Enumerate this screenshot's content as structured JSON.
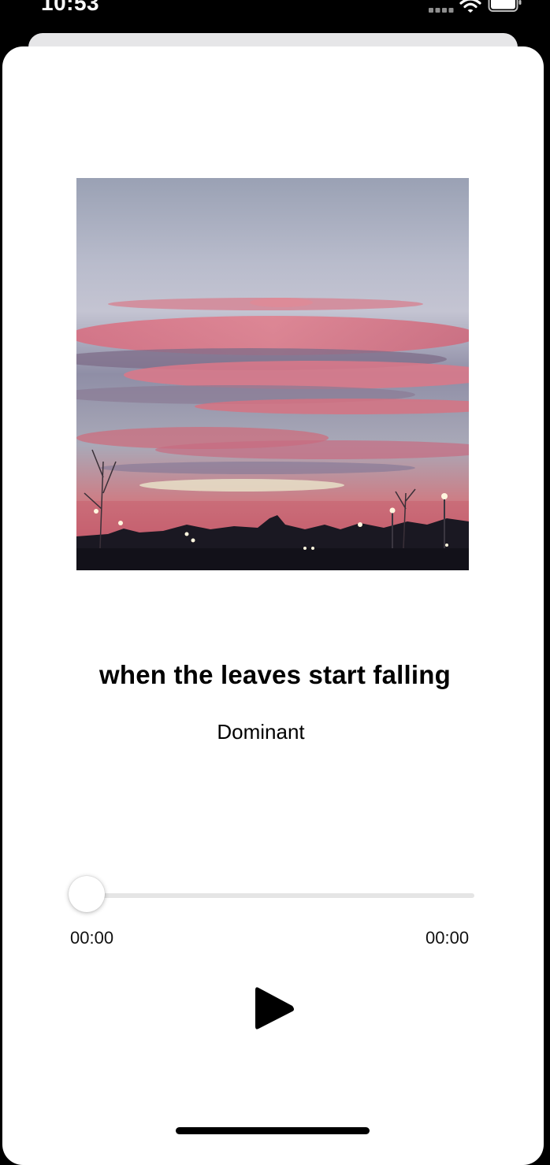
{
  "status_bar": {
    "time": "10:53",
    "icons": [
      "signal-icon",
      "wifi-icon",
      "battery-icon"
    ]
  },
  "player": {
    "artwork_icon": "album-artwork-sunset",
    "title": "when the leaves start falling",
    "artist": "Dominant",
    "progress_fraction": 0,
    "elapsed": "00:00",
    "duration": "00:00",
    "play_icon": "play-icon"
  },
  "colors": {
    "background": "#000000",
    "sheet": "#ffffff",
    "text": "#000000",
    "track": "#e5e5e5"
  }
}
